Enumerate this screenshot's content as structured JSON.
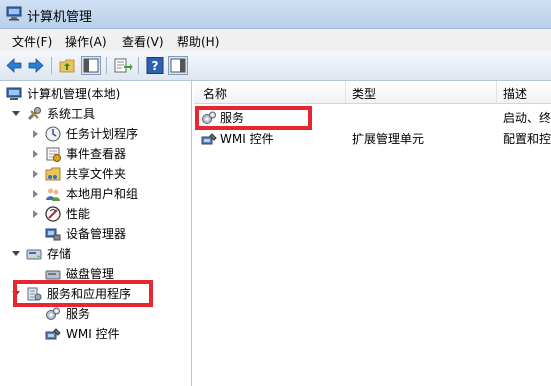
{
  "window": {
    "title": "计算机管理"
  },
  "menu": {
    "file": "文件(F)",
    "action": "操作(A)",
    "view": "查看(V)",
    "help": "帮助(H)"
  },
  "tree": {
    "root": "计算机管理(本地)",
    "system_tools": "系统工具",
    "task_scheduler": "任务计划程序",
    "event_viewer": "事件查看器",
    "shared_folders": "共享文件夹",
    "local_users": "本地用户和组",
    "performance": "性能",
    "device_manager": "设备管理器",
    "storage": "存储",
    "disk_management": "磁盘管理",
    "services_apps": "服务和应用程序",
    "services": "服务",
    "wmi": "WMI 控件"
  },
  "list": {
    "columns": {
      "name": "名称",
      "type": "类型",
      "desc": "描述"
    },
    "rows": [
      {
        "name": "服务",
        "type": "",
        "desc": "启动、终"
      },
      {
        "name": "WMI 控件",
        "type": "扩展管理单元",
        "desc": "配置和控"
      }
    ]
  },
  "colors": {
    "highlight": "#e8262f"
  }
}
